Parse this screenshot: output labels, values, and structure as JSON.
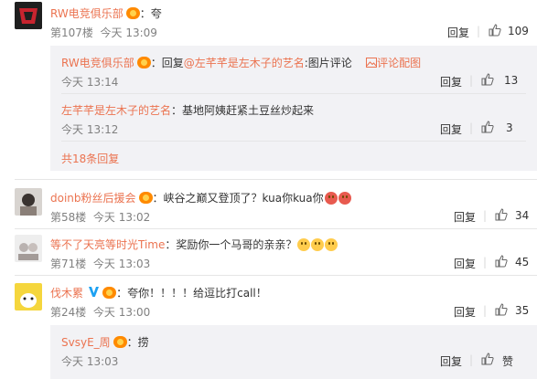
{
  "comments": [
    {
      "user": "RW电竞俱乐部",
      "sep": "：",
      "text": "夸",
      "floor": "第107楼",
      "time": "今天 13:09",
      "reply_label": "回复",
      "likes": "109"
    },
    {
      "user": "doinb粉丝后援会",
      "sep": "：",
      "text": "峡谷之巅又登顶了？kua你kua你",
      "floor": "第58楼",
      "time": "今天 13:02",
      "reply_label": "回复",
      "likes": "34"
    },
    {
      "user": "等不了天亮等时光Time",
      "sep": "：",
      "text": "奖励你一个马哥的亲亲？",
      "floor": "第71楼",
      "time": "今天 13:03",
      "reply_label": "回复",
      "likes": "45"
    },
    {
      "user": "伐木累",
      "sep": "：",
      "text": "夸你！！！！给逗比打call！",
      "floor": "第24楼",
      "time": "今天 13:00",
      "reply_label": "回复",
      "likes": "35"
    }
  ],
  "sub_replies_1": [
    {
      "user": "RW电竞俱乐部",
      "sep": "：",
      "reply_word": "回复",
      "mention": "@左芊芊是左木子的艺名",
      "text": ":图片评论",
      "pic_link": "评论配图",
      "time": "今天 13:14",
      "reply_label": "回复",
      "likes": "13"
    },
    {
      "user": "左芊芊是左木子的艺名",
      "sep": "：",
      "text": "基地阿姨赶紧土豆丝炒起来",
      "time": "今天 13:12",
      "reply_label": "回复",
      "likes": "3"
    }
  ],
  "more_replies": "共18条回复",
  "sub_replies_4": [
    {
      "user": "SvsyE_周",
      "sep": "：",
      "text": "捞",
      "time": "今天 13:03",
      "reply_label": "回复",
      "likes": "赞"
    }
  ],
  "icons": {
    "like": "thumbs-up-icon",
    "picture": "picture-icon",
    "vip": "vip-badge-icon",
    "verified": "verified-v-icon"
  },
  "colors": {
    "username": "#eb7350",
    "reply_bg": "#f2f2f5",
    "verified": "#1da1f2"
  }
}
